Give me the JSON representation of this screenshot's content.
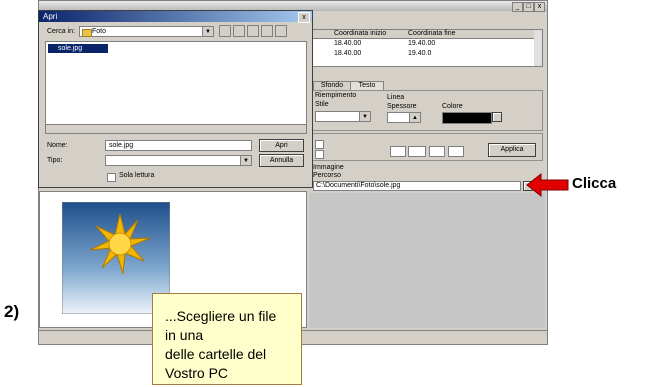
{
  "dialog": {
    "title": "Apri",
    "look_in_label": "Cerca in:",
    "look_in_value": "Foto",
    "selected_file": "sole.jpg",
    "filename_label": "Nome:",
    "filename_value": "sole.jpg",
    "filetype_label": "Tipo:",
    "filetype_value": "",
    "open_button": "Apri",
    "cancel_button": "Annulla",
    "readonly_label": "Sola lettura"
  },
  "panel": {
    "table_headers": [
      "Coordinata inizio",
      "Coordinata fine"
    ],
    "table_rows": [
      [
        "18.40.00",
        "19.40.00"
      ],
      [
        "18.40.00",
        "19.40.0"
      ]
    ],
    "tabs": [
      "Sfondo",
      "Testo"
    ],
    "fill_label": "Riempimento",
    "style_label": "Stile",
    "line_label": "Linea",
    "thickness_label": "Spessore",
    "color_label": "Colore",
    "image_label": "Immagine",
    "path_label": "Percorso",
    "path_value": "C:\\Documenti\\Foto\\sole.jpg",
    "apply_button": "Applica"
  },
  "callout": {
    "line1": "...Scegliere un file in una",
    "line2": "delle cartelle del Vostro PC"
  },
  "annotation": {
    "clicca": "Clicca",
    "step": "2)"
  },
  "colors": {
    "arrow": "#e00000",
    "callout_bg": "#ffffcc",
    "selection": "#0a246a"
  }
}
